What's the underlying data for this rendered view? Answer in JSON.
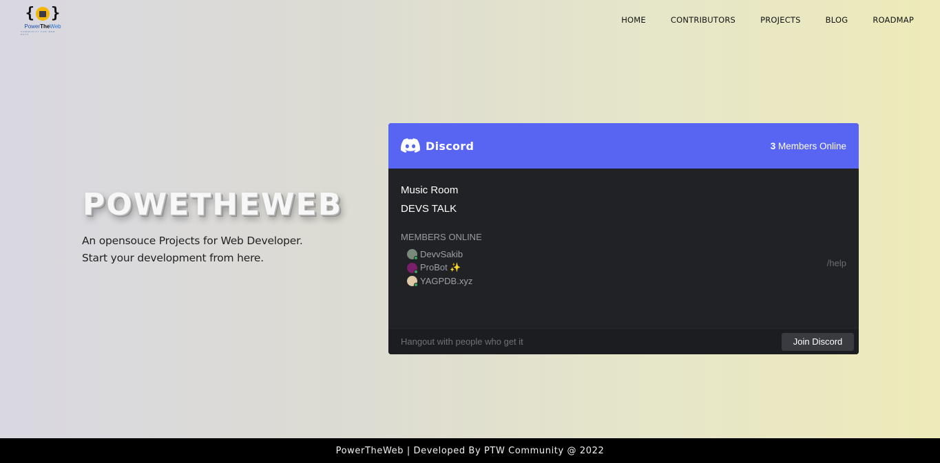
{
  "logo": {
    "brace_left": "{",
    "brace_right": "}",
    "text_a": "Power",
    "text_b": "The",
    "text_c": "Web",
    "tagline": "COMMUNITY FOR WEB DEVS",
    "icon": "monitor-icon"
  },
  "nav": {
    "items": [
      {
        "label": "HOME"
      },
      {
        "label": "CONTRIBUTORS"
      },
      {
        "label": "PROJECTS"
      },
      {
        "label": "BLOG"
      },
      {
        "label": "ROADMAP"
      }
    ]
  },
  "hero": {
    "title": "POWETHEWEB",
    "subtitle_line1": "An opensouce Projects for Web Developer.",
    "subtitle_line2": "Start your development from here."
  },
  "discord": {
    "brand": "Discord",
    "brand_icon": "discord-logo-icon",
    "online_count": "3",
    "online_label": " Members Online",
    "channels": [
      "Music Room",
      "DEVS TALK"
    ],
    "members_title": "MEMBERS ONLINE",
    "members": [
      {
        "name": "DevvSakib",
        "avatar_color": "#7a8a7a"
      },
      {
        "name": "ProBot ✨",
        "avatar_color": "#7a1f6a"
      },
      {
        "name": "YAGPDB.xyz",
        "avatar_color": "#e0c9a6"
      }
    ],
    "help_text": "/help",
    "footer_text": "Hangout with people who get it",
    "join_label": "Join Discord",
    "header_color": "#5865f2",
    "body_color": "#212226"
  },
  "footer": {
    "text": "PowerTheWeb | Developed By PTW Community @ 2022"
  }
}
